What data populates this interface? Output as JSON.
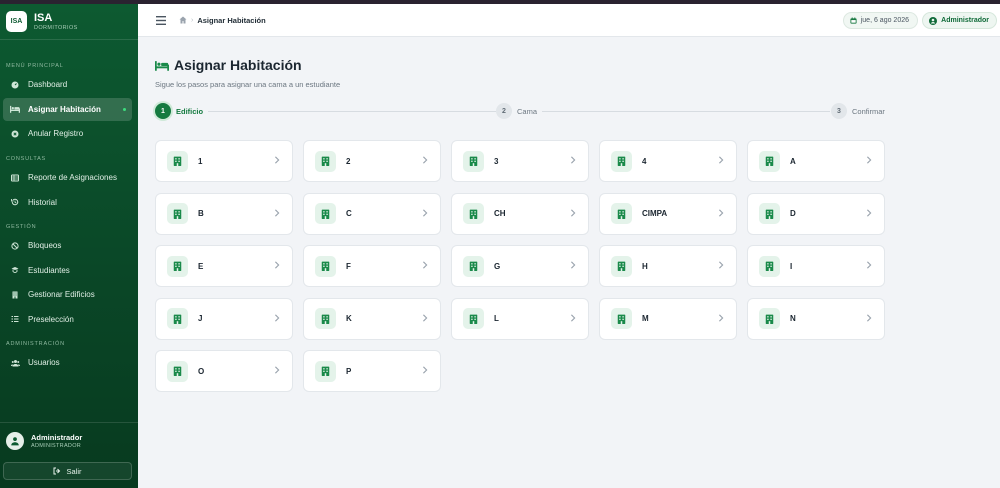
{
  "brand": {
    "logo_text": "ISA",
    "title": "ISA",
    "subtitle": "DORMITORIOS"
  },
  "sidebar": {
    "sections": [
      {
        "label": "MENÚ PRINCIPAL",
        "items": [
          {
            "label": "Dashboard",
            "icon": "gauge-icon",
            "active": false
          },
          {
            "label": "Asignar Habitación",
            "icon": "bed-icon",
            "active": true
          },
          {
            "label": "Anular Registro",
            "icon": "x-circle-icon",
            "active": false
          }
        ]
      },
      {
        "label": "CONSULTAS",
        "items": [
          {
            "label": "Reporte de Asignaciones",
            "icon": "table-icon",
            "active": false
          },
          {
            "label": "Historial",
            "icon": "history-icon",
            "active": false
          }
        ]
      },
      {
        "label": "GESTIÓN",
        "items": [
          {
            "label": "Bloqueos",
            "icon": "ban-icon",
            "active": false
          },
          {
            "label": "Estudiantes",
            "icon": "student-icon",
            "active": false
          },
          {
            "label": "Gestionar Edificios",
            "icon": "building-icon",
            "active": false
          },
          {
            "label": "Preselección",
            "icon": "list-check-icon",
            "active": false
          }
        ]
      },
      {
        "label": "ADMINISTRACIÓN",
        "items": [
          {
            "label": "Usuarios",
            "icon": "users-icon",
            "active": false
          }
        ]
      }
    ],
    "user": {
      "name": "Administrador",
      "role": "ADMINISTRADOR"
    },
    "logout_label": "Salir"
  },
  "topbar": {
    "breadcrumb_current": "Asignar Habitación",
    "breadcrumb_separator": "›",
    "date": "jue, 6 ago 2026",
    "user_label": "Administrador"
  },
  "page": {
    "title": "Asignar Habitación",
    "subtitle": "Sigue los pasos para asignar una cama a un estudiante"
  },
  "stepper": [
    {
      "number": "1",
      "label": "Edificio",
      "active": true
    },
    {
      "number": "2",
      "label": "Cama",
      "active": false
    },
    {
      "number": "3",
      "label": "Confirmar",
      "active": false
    }
  ],
  "buildings": [
    "1",
    "2",
    "3",
    "4",
    "A",
    "B",
    "C",
    "CH",
    "CIMPA",
    "D",
    "E",
    "F",
    "G",
    "H",
    "I",
    "J",
    "K",
    "L",
    "M",
    "N",
    "O",
    "P"
  ],
  "colors": {
    "primary": "#157a40",
    "sidebar": "#0d5a31",
    "accent_dot": "#3ddc7d",
    "background": "#f2f4f7"
  }
}
